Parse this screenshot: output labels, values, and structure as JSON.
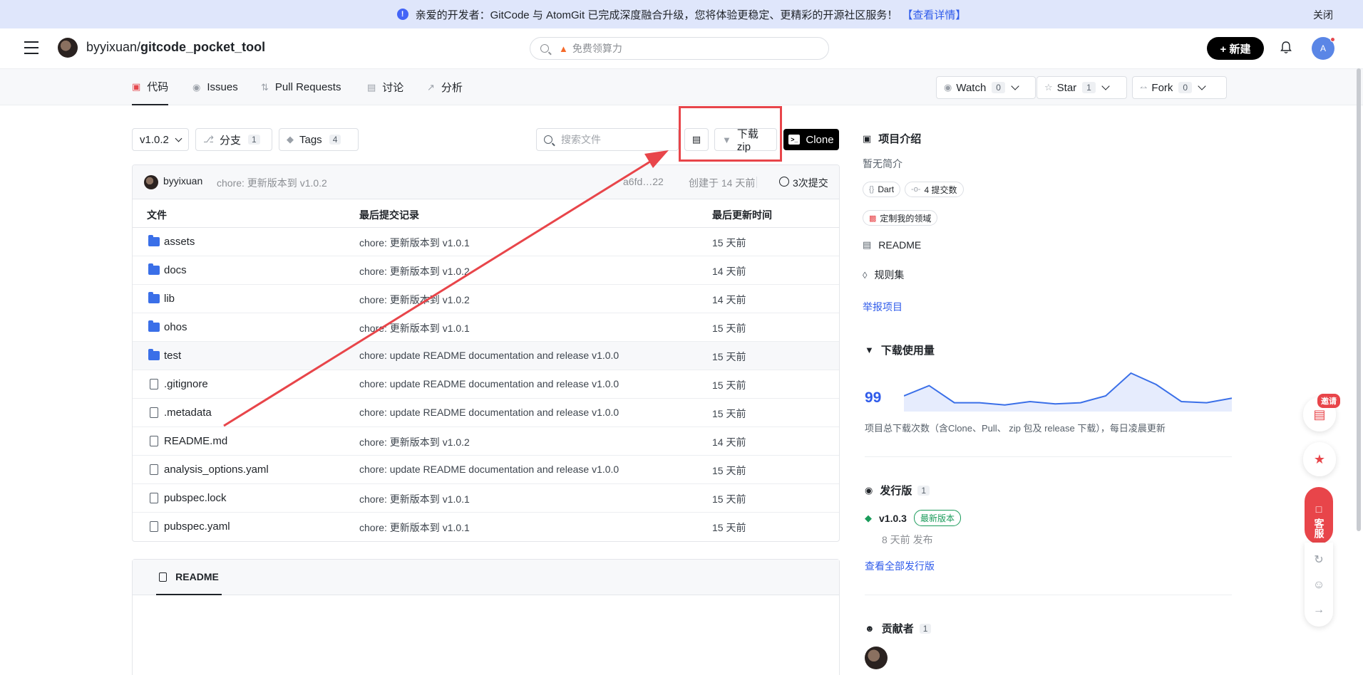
{
  "banner": {
    "text": "亲爱的开发者：GitCode 与 AtomGit 已完成深度融合升级，您将体验更稳定、更精彩的开源社区服务！",
    "link": "【查看详情】",
    "close": "关闭"
  },
  "header": {
    "owner": "byyixuan/",
    "repo": "gitcode_pocket_tool",
    "search_placeholder": "免费领算力",
    "new_label": "+ 新建",
    "avatar_letter": "A"
  },
  "tabs": [
    {
      "label": "代码"
    },
    {
      "label": "Issues"
    },
    {
      "label": "Pull Requests"
    },
    {
      "label": "讨论"
    },
    {
      "label": "分析"
    }
  ],
  "repo_actions": {
    "watch": {
      "label": "Watch",
      "count": "0"
    },
    "star": {
      "label": "Star",
      "count": "1"
    },
    "fork": {
      "label": "Fork",
      "count": "0"
    }
  },
  "toolbar": {
    "branch": "v1.0.2",
    "branches_label": "分支",
    "branches_count": "1",
    "tags_label": "Tags",
    "tags_count": "4",
    "file_search_placeholder": "搜索文件",
    "download_zip": "下载zip",
    "clone": "Clone"
  },
  "last_commit": {
    "user": "byyixuan",
    "message": "chore: 更新版本到 v1.0.2",
    "sha": "a6fd…22",
    "created": "创建于 14 天前",
    "commits": "3次提交"
  },
  "table": {
    "headers": [
      "文件",
      "最后提交记录",
      "最后更新时间"
    ],
    "rows": [
      {
        "type": "folder",
        "name": "assets",
        "msg": "chore: 更新版本到 v1.0.1",
        "time": "15 天前"
      },
      {
        "type": "folder",
        "name": "docs",
        "msg": "chore: 更新版本到 v1.0.2",
        "time": "14 天前"
      },
      {
        "type": "folder",
        "name": "lib",
        "msg": "chore: 更新版本到 v1.0.2",
        "time": "14 天前"
      },
      {
        "type": "folder",
        "name": "ohos",
        "msg": "chore: 更新版本到 v1.0.1",
        "time": "15 天前"
      },
      {
        "type": "folder",
        "name": "test",
        "msg": "chore: update README documentation and release v1.0.0",
        "time": "15 天前"
      },
      {
        "type": "file",
        "name": ".gitignore",
        "msg": "chore: update README documentation and release v1.0.0",
        "time": "15 天前"
      },
      {
        "type": "file",
        "name": ".metadata",
        "msg": "chore: update README documentation and release v1.0.0",
        "time": "15 天前"
      },
      {
        "type": "file",
        "name": "README.md",
        "msg": "chore: 更新版本到 v1.0.2",
        "time": "14 天前"
      },
      {
        "type": "file",
        "name": "analysis_options.yaml",
        "msg": "chore: update README documentation and release v1.0.0",
        "time": "15 天前"
      },
      {
        "type": "file",
        "name": "pubspec.lock",
        "msg": "chore: 更新版本到 v1.0.1",
        "time": "15 天前"
      },
      {
        "type": "file",
        "name": "pubspec.yaml",
        "msg": "chore: 更新版本到 v1.0.1",
        "time": "15 天前"
      }
    ]
  },
  "readme": {
    "tab": "README"
  },
  "sidebar": {
    "intro_title": "项目介绍",
    "intro_text": "暂无简介",
    "lang_tag": "Dart",
    "commits_tag": "4 提交数",
    "domain_tag": "定制我的领域",
    "readme_link": "README",
    "rules_link": "规则集",
    "report_link": "举报项目",
    "downloads_title": "下载使用量",
    "downloads_count": "99",
    "downloads_desc": "项目总下载次数（含Clone、Pull、 zip 包及 release 下载），每日凌晨更新",
    "downloads_trend": [
      10,
      19,
      4,
      4,
      2,
      5,
      3,
      4,
      10,
      30,
      20,
      5,
      4,
      8
    ],
    "release_title": "发行版",
    "release_count": "1",
    "release_version": "v1.0.3",
    "release_badge": "最新版本",
    "release_time": "8 天前 发布",
    "all_releases": "查看全部发行版",
    "contributors_title": "贡献者",
    "contributors_count": "1"
  },
  "floating": {
    "invite": "邀请",
    "customer_service": "客服"
  },
  "colors": {
    "accent_blue": "#2f5bea",
    "highlight_red": "#e8454a",
    "folder_blue": "#3a6fe8",
    "release_green": "#1a9b5a"
  }
}
